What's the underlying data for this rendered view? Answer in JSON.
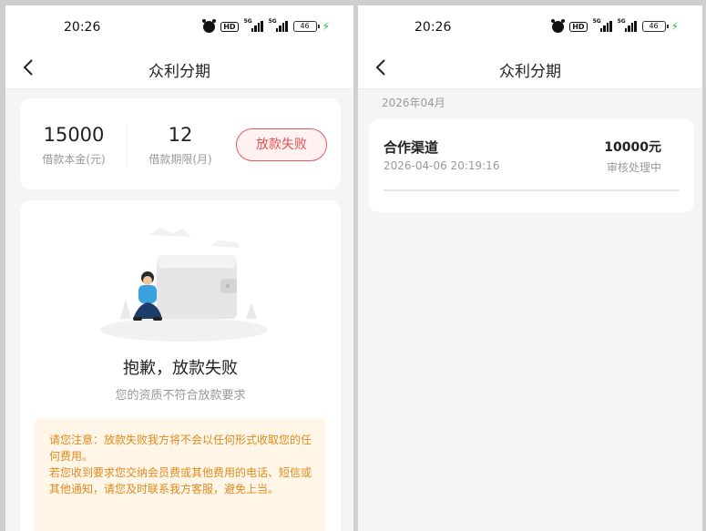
{
  "status_bar": {
    "time": "20:26",
    "hd": "HD",
    "signal_tag": "5G",
    "battery": "46"
  },
  "nav": {
    "title": "众利分期"
  },
  "loan": {
    "principal_value": "15000",
    "principal_label": "借款本金(元)",
    "term_value": "12",
    "term_label": "借款期限(月)",
    "status_button": "放款失败"
  },
  "failure": {
    "title": "抱歉，放款失败",
    "subtitle": "您的资质不符合放款要求",
    "notice_line1": "请您注意：放款失败我方将不会以任何形式收取您的任何费用。",
    "notice_line2": "若您收到要求您交纳会员费或其他费用的电话、短信或其他通知，请您及时联系我方客服，避免上当。"
  },
  "records": {
    "month": "2026年04月",
    "items": [
      {
        "name": "合作渠道",
        "datetime": "2026-04-06 20:19:16",
        "amount": "10000元",
        "status": "审核处理中"
      }
    ]
  },
  "colors": {
    "accent_red": "#e45050",
    "notice_text": "#e08a1e",
    "notice_bg": "#fff6e8",
    "charging_green": "#2bb34a"
  }
}
